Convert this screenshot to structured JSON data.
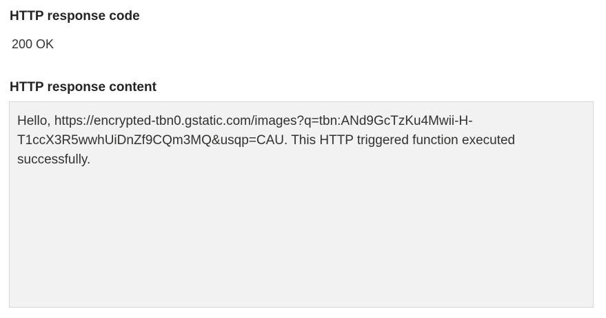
{
  "response_code": {
    "label": "HTTP response code",
    "value": "200 OK"
  },
  "response_content": {
    "label": "HTTP response content",
    "text": "Hello, https://encrypted-tbn0.gstatic.com/images?q=tbn:ANd9GcTzKu4Mwii-H-\nT1ccX3R5wwhUiDnZf9CQm3MQ&usqp=CAU. This HTTP triggered function executed\nsuccessfully."
  },
  "colors": {
    "content_background": "#f2f2f2",
    "content_border": "#d6d6d6",
    "text": "#323130"
  }
}
